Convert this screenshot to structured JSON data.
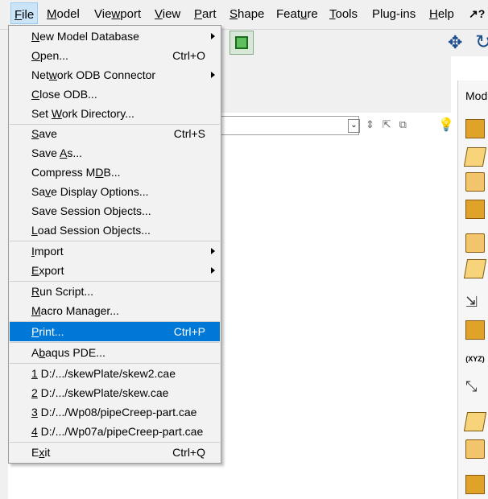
{
  "menubar": [
    {
      "id": "file",
      "pre": "",
      "u": "F",
      "post": "ile",
      "active": true
    },
    {
      "id": "model",
      "pre": "",
      "u": "M",
      "post": "odel",
      "active": false
    },
    {
      "id": "viewport",
      "pre": "Vie",
      "u": "w",
      "post": "port",
      "active": false
    },
    {
      "id": "view",
      "pre": "",
      "u": "V",
      "post": "iew",
      "active": false
    },
    {
      "id": "part",
      "pre": "",
      "u": "P",
      "post": "art",
      "active": false
    },
    {
      "id": "shape",
      "pre": "",
      "u": "S",
      "post": "hape",
      "active": false
    },
    {
      "id": "feature",
      "pre": "Feat",
      "u": "u",
      "post": "re",
      "active": false
    },
    {
      "id": "tools",
      "pre": "",
      "u": "T",
      "post": "ools",
      "active": false
    },
    {
      "id": "plugins",
      "pre": "Plug-ins",
      "u": "",
      "post": "",
      "active": false
    },
    {
      "id": "help",
      "pre": "",
      "u": "H",
      "post": "elp",
      "active": false
    }
  ],
  "help_glyph": "↗?",
  "background": {
    "module_label": "Mod",
    "coords_tool_label": "(XYZ)"
  },
  "file_menu": [
    {
      "id": "new-model-database",
      "pre": "",
      "u": "N",
      "post": "ew Model Database",
      "shortcut": "",
      "submenu": true
    },
    {
      "id": "open",
      "pre": "",
      "u": "O",
      "post": "pen...",
      "shortcut": "Ctrl+O",
      "submenu": false
    },
    {
      "id": "network-odb-connector",
      "pre": "Net",
      "u": "w",
      "post": "ork ODB Connector",
      "shortcut": "",
      "submenu": true
    },
    {
      "id": "close-odb",
      "pre": "",
      "u": "C",
      "post": "lose ODB...",
      "shortcut": "",
      "submenu": false
    },
    {
      "id": "set-work-directory",
      "pre": "Set ",
      "u": "W",
      "post": "ork Directory...",
      "shortcut": "",
      "submenu": false
    },
    {
      "id": "save",
      "pre": "",
      "u": "S",
      "post": "ave",
      "shortcut": "Ctrl+S",
      "submenu": false
    },
    {
      "id": "save-as",
      "pre": "Save ",
      "u": "A",
      "post": "s...",
      "shortcut": "",
      "submenu": false
    },
    {
      "id": "compress-mdb",
      "pre": "Compress M",
      "u": "D",
      "post": "B...",
      "shortcut": "",
      "submenu": false
    },
    {
      "id": "save-display-options",
      "pre": "Sa",
      "u": "v",
      "post": "e Display Options...",
      "shortcut": "",
      "submenu": false
    },
    {
      "id": "save-session-objects",
      "pre": "Save Session Objects...",
      "u": "",
      "post": "",
      "shortcut": "",
      "submenu": false
    },
    {
      "id": "load-session-objects",
      "pre": "",
      "u": "L",
      "post": "oad Session Objects...",
      "shortcut": "",
      "submenu": false
    },
    {
      "id": "import",
      "pre": "",
      "u": "I",
      "post": "mport",
      "shortcut": "",
      "submenu": true
    },
    {
      "id": "export",
      "pre": "",
      "u": "E",
      "post": "xport",
      "shortcut": "",
      "submenu": true
    },
    {
      "id": "run-script",
      "pre": "",
      "u": "R",
      "post": "un Script...",
      "shortcut": "",
      "submenu": false
    },
    {
      "id": "macro-manager",
      "pre": "",
      "u": "M",
      "post": "acro Manager...",
      "shortcut": "",
      "submenu": false
    },
    {
      "id": "print",
      "pre": "",
      "u": "P",
      "post": "rint...",
      "shortcut": "Ctrl+P",
      "submenu": false,
      "highlighted": true
    },
    {
      "id": "abaqus-pde",
      "pre": "A",
      "u": "b",
      "post": "aqus PDE...",
      "shortcut": "",
      "submenu": false
    },
    {
      "id": "recent-1",
      "pre": "",
      "u": "1",
      "post": " D:/.../skewPlate/skew2.cae",
      "shortcut": "",
      "submenu": false
    },
    {
      "id": "recent-2",
      "pre": "",
      "u": "2",
      "post": " D:/.../skewPlate/skew.cae",
      "shortcut": "",
      "submenu": false
    },
    {
      "id": "recent-3",
      "pre": "",
      "u": "3",
      "post": " D:/.../Wp08/pipeCreep-part.cae",
      "shortcut": "",
      "submenu": false
    },
    {
      "id": "recent-4",
      "pre": "",
      "u": "4",
      "post": " D:/.../Wp07a/pipeCreep-part.cae",
      "shortcut": "",
      "submenu": false
    },
    {
      "id": "exit",
      "pre": "E",
      "u": "x",
      "post": "it",
      "shortcut": "Ctrl+Q",
      "submenu": false
    }
  ]
}
